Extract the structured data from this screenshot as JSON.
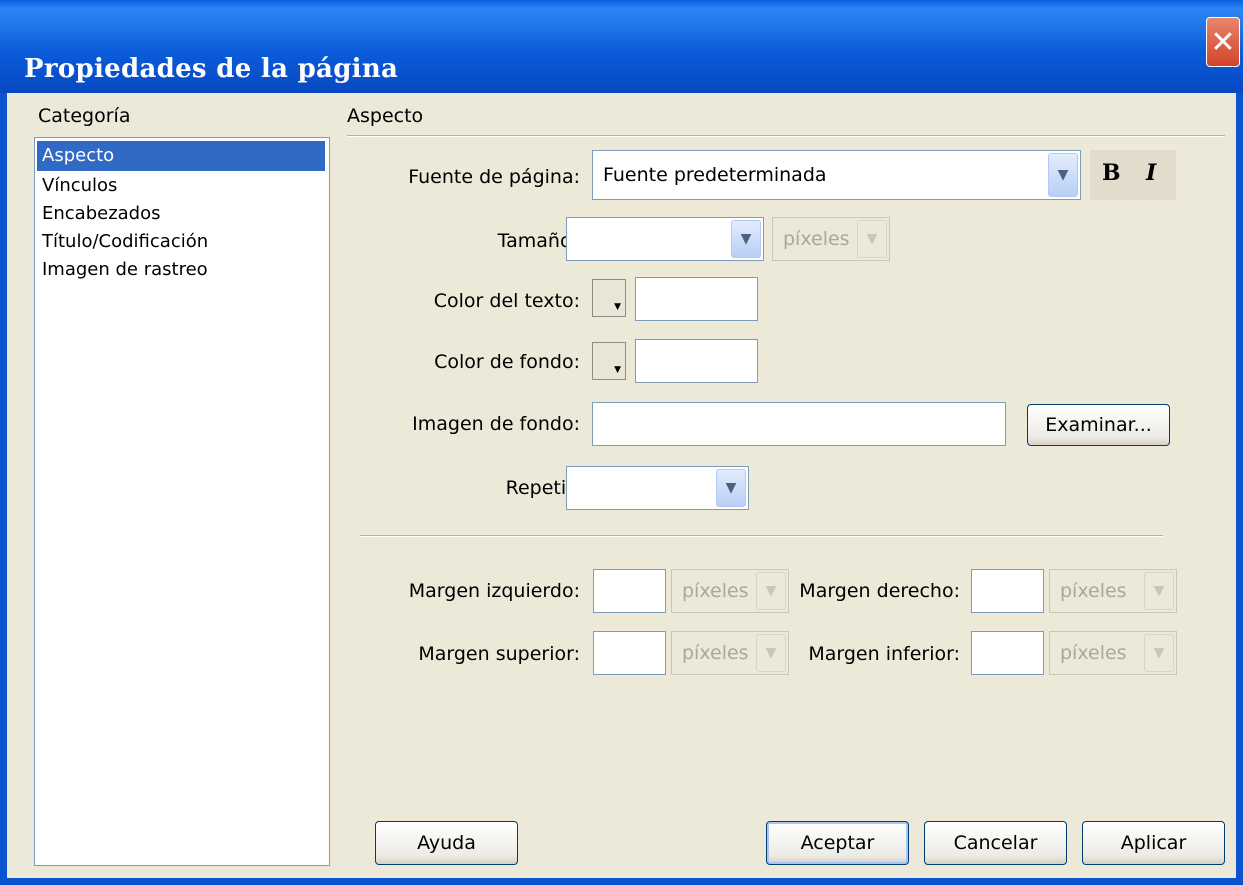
{
  "window": {
    "title": "Propiedades de la página"
  },
  "category": {
    "label": "Categoría",
    "items": [
      "Aspecto",
      "Vínculos",
      "Encabezados",
      "Título/Codificación",
      "Imagen de rastreo"
    ],
    "selected": "Aspecto"
  },
  "panel": {
    "heading": "Aspecto",
    "font": {
      "label": "Fuente de página:",
      "value": "Fuente predeterminada",
      "bold": "B",
      "italic": "I"
    },
    "size": {
      "label": "Tamaño:",
      "value": "",
      "unit": "píxeles"
    },
    "text_color": {
      "label": "Color del texto:",
      "value": ""
    },
    "bg_color": {
      "label": "Color de fondo:",
      "value": ""
    },
    "bg_image": {
      "label": "Imagen de fondo:",
      "value": "",
      "browse": "Examinar..."
    },
    "repeat": {
      "label": "Repetir:",
      "value": ""
    },
    "margins": {
      "left": {
        "label": "Margen izquierdo:",
        "value": "",
        "unit": "píxeles"
      },
      "right": {
        "label": "Margen derecho:",
        "value": "",
        "unit": "píxeles"
      },
      "top": {
        "label": "Margen superior:",
        "value": "",
        "unit": "píxeles"
      },
      "bottom": {
        "label": "Margen inferior:",
        "value": "",
        "unit": "píxeles"
      }
    }
  },
  "buttons": {
    "help": "Ayuda",
    "ok": "Aceptar",
    "cancel": "Cancelar",
    "apply": "Aplicar"
  },
  "icons": {
    "close": "close-icon",
    "dropdown": "chevron-down-icon",
    "color_picker": "color-swatch-icon"
  }
}
